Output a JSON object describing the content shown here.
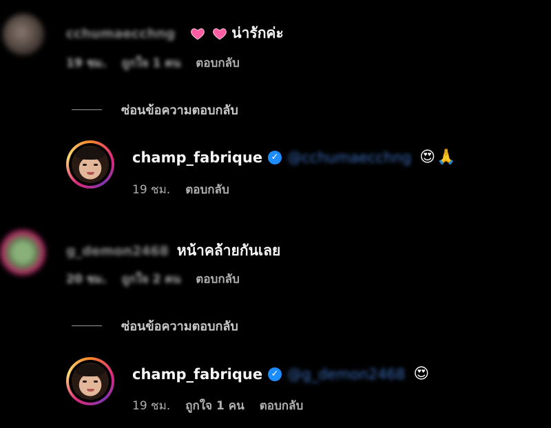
{
  "comments": [
    {
      "username": "cchumaecchng",
      "text": "น่ารักค่ะ",
      "time": "19 ชม.",
      "likes": "ถูกใจ 1 คน",
      "reply": "ตอบกลับ",
      "hide_replies": "ซ่อนข้อความตอบกลับ",
      "reply_item": {
        "username": "champ_fabrique",
        "mention": "@cchumaecchng",
        "time": "19 ชม.",
        "reply": "ตอบกลับ"
      }
    },
    {
      "username": "g_demon2468",
      "text": "หน้าคล้ายกันเลย",
      "time": "20 ชม.",
      "likes": "ถูกใจ 2 คน",
      "reply": "ตอบกลับ",
      "hide_replies": "ซ่อนข้อความตอบกลับ",
      "reply_item": {
        "username": "champ_fabrique",
        "mention": "@g_demon2468",
        "time": "19 ชม.",
        "likes": "ถูกใจ 1 คน",
        "reply": "ตอบกลับ"
      }
    }
  ],
  "icons": {
    "verified": "verified-check-icon",
    "heart": "pink-heart-emoji",
    "star_eyes": "star-struck-emoji",
    "pray": "folded-hands-emoji"
  },
  "colors": {
    "background": "#000000",
    "verified": "#1c8cff",
    "mention": "#3a6bb8",
    "heart": "#ff5fa2"
  }
}
